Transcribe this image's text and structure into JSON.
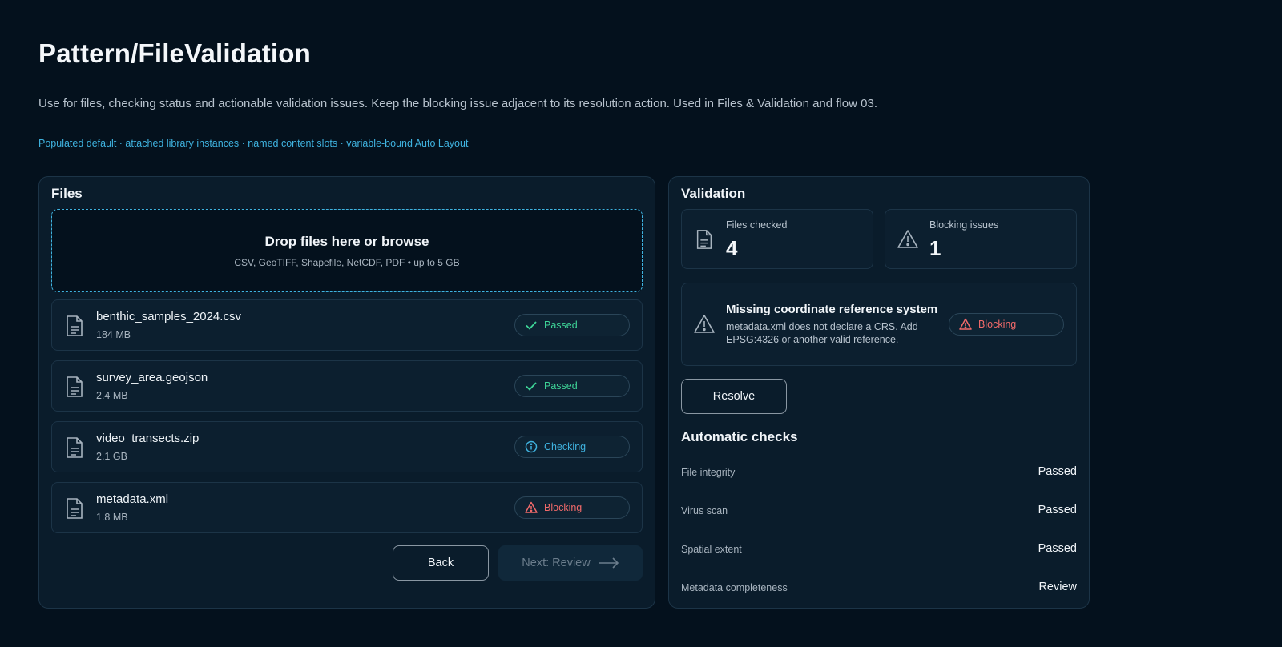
{
  "header": {
    "title": "Pattern/FileValidation",
    "description": "Use for files, checking status and actionable validation issues. Keep the blocking issue adjacent to its resolution action. Used in Files & Validation and flow 03.",
    "meta": "Populated default · attached library instances · named content slots · variable-bound Auto Layout"
  },
  "files_panel": {
    "title": "Files",
    "dropzone": {
      "title": "Drop files here or browse",
      "subtitle": "CSV, GeoTIFF, Shapefile, NetCDF, PDF • up to 5 GB"
    },
    "files": [
      {
        "name": "benthic_samples_2024.csv",
        "size": "184 MB",
        "status": "Passed",
        "status_icon": "check-icon"
      },
      {
        "name": "survey_area.geojson",
        "size": "2.4 MB",
        "status": "Passed",
        "status_icon": "check-icon"
      },
      {
        "name": "video_transects.zip",
        "size": "2.1 GB",
        "status": "Checking",
        "status_icon": "info-icon"
      },
      {
        "name": "metadata.xml",
        "size": "1.8 MB",
        "status": "Blocking",
        "status_icon": "warning-icon"
      }
    ],
    "back_label": "Back",
    "next_label": "Next: Review"
  },
  "validation_panel": {
    "title": "Validation",
    "stats": {
      "files_checked_label": "Files checked",
      "files_checked_value": "4",
      "blocking_label": "Blocking issues",
      "blocking_value": "1"
    },
    "issue": {
      "title": "Missing coordinate reference system",
      "description": "metadata.xml does not declare a CRS. Add EPSG:4326 or another valid reference.",
      "badge": "Blocking"
    },
    "resolve_label": "Resolve",
    "checks_title": "Automatic checks",
    "checks": [
      {
        "label": "File integrity",
        "value": "Passed"
      },
      {
        "label": "Virus scan",
        "value": "Passed"
      },
      {
        "label": "Spatial extent",
        "value": "Passed"
      },
      {
        "label": "Metadata completeness",
        "value": "Review"
      }
    ]
  },
  "colors": {
    "background": "#04111d",
    "panel": "#0a1c2b",
    "accent": "#3fb3e0",
    "passed": "#3ed598",
    "blocking": "#f26a6a"
  }
}
